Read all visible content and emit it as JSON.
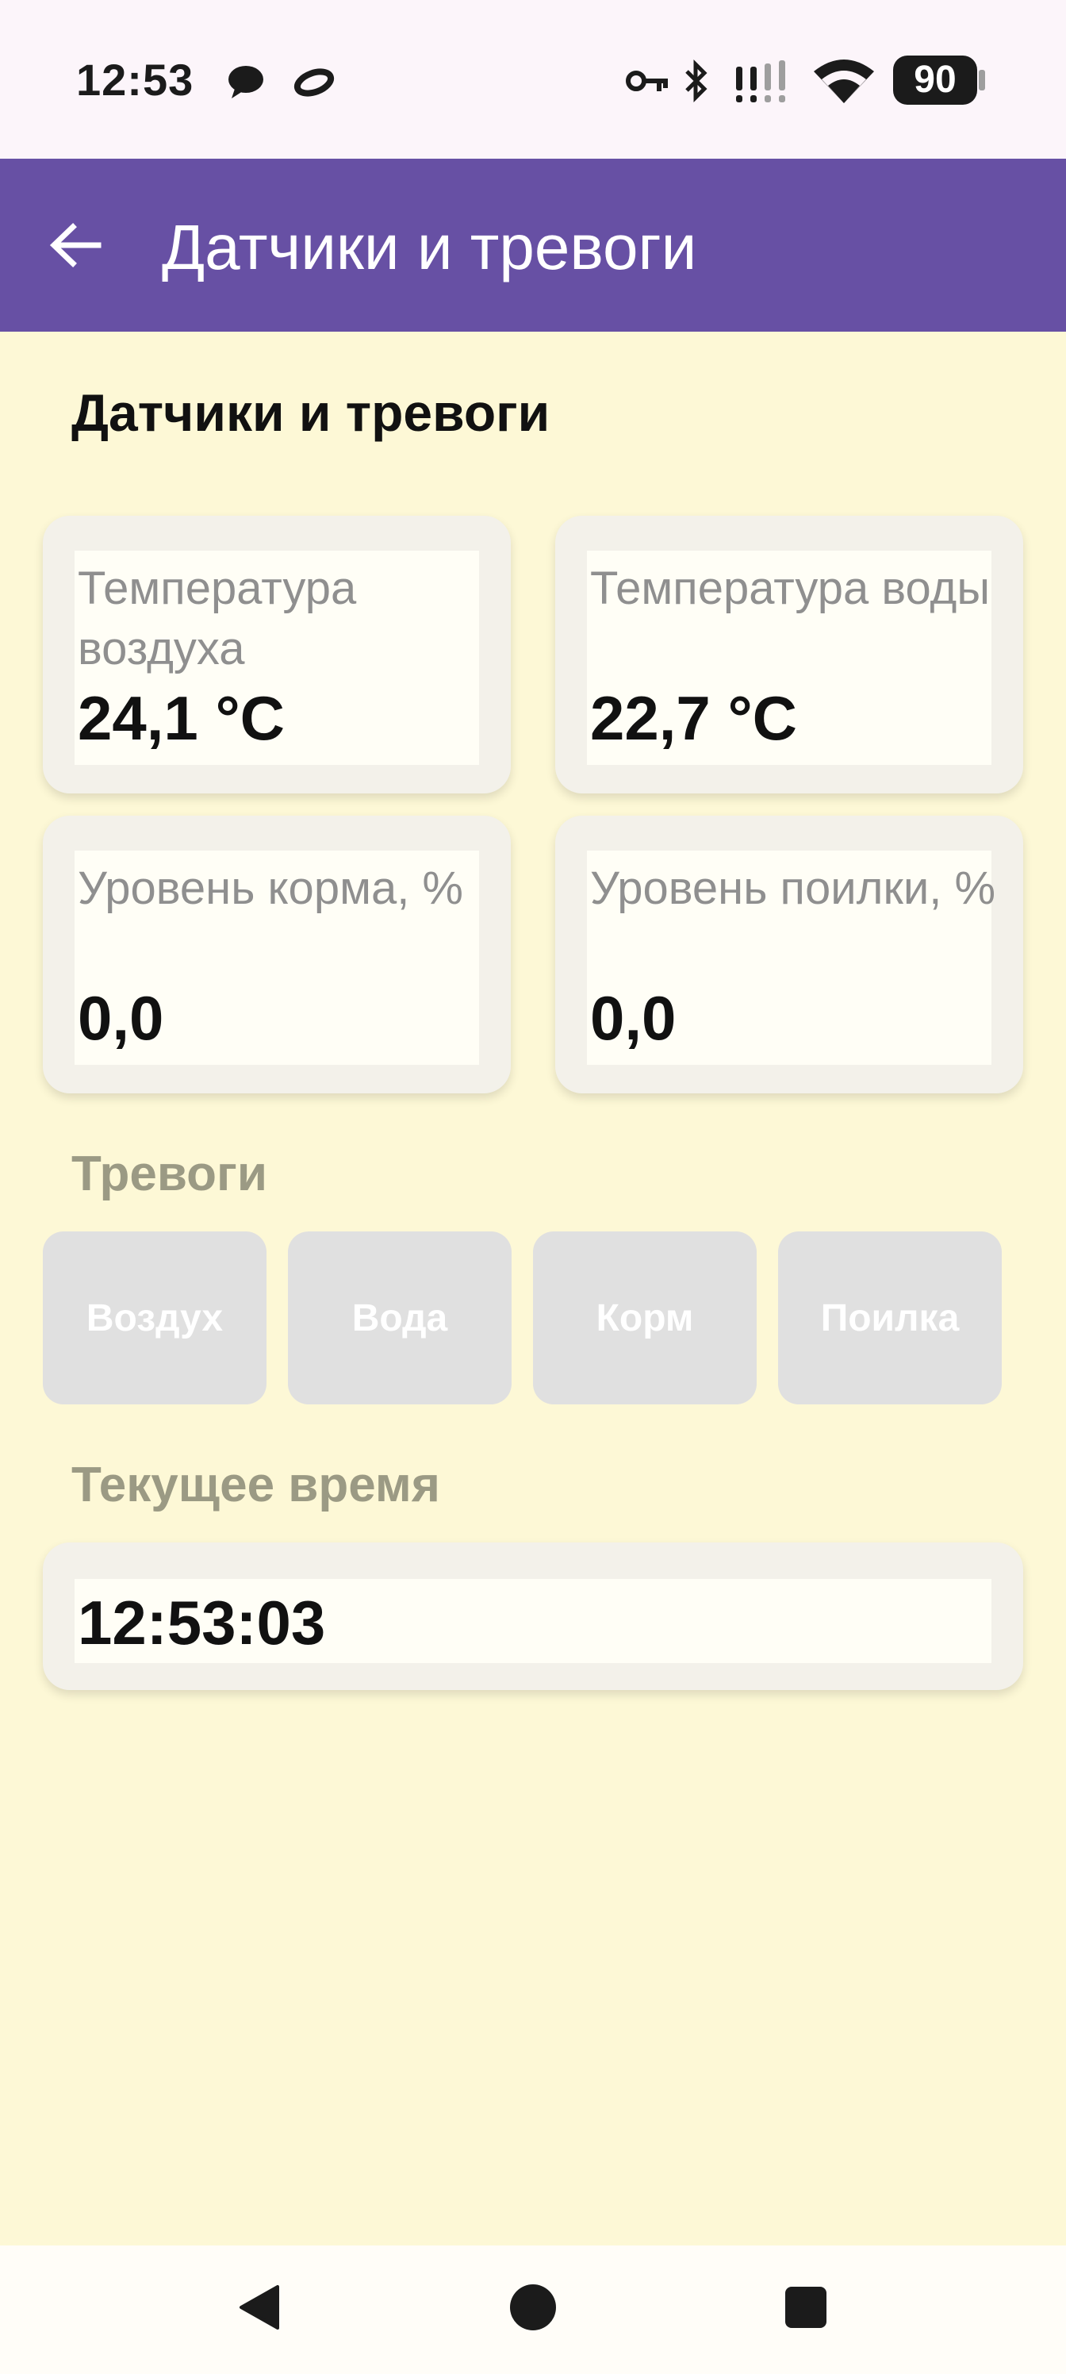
{
  "status_bar": {
    "time": "12:53",
    "battery": "90",
    "icons": [
      "chat-bubble-icon",
      "app-notification-icon",
      "vpn-key-icon",
      "bluetooth-icon",
      "signal-icon",
      "wifi-icon",
      "battery-icon"
    ]
  },
  "app_bar": {
    "title": "Датчики и тревоги",
    "back_icon": "arrow-left-icon",
    "background": "#6750a4"
  },
  "page": {
    "heading": "Датчики и тревоги",
    "background": "#fdf8d6"
  },
  "sensors": [
    {
      "label": "Температура воздуха",
      "value": "24,1 °C"
    },
    {
      "label": "Температура воды",
      "value": "22,7 °C"
    },
    {
      "label": "Уровень корма, %",
      "value": "0,0"
    },
    {
      "label": "Уровень поилки, %",
      "value": "0,0"
    }
  ],
  "alarms": {
    "title": "Тревоги",
    "buttons": [
      "Воздух",
      "Вода",
      "Корм",
      "Поилка"
    ]
  },
  "current_time": {
    "title": "Текущее время",
    "value": "12:53:03"
  },
  "nav": {
    "icons": [
      "back-triangle-icon",
      "home-circle-icon",
      "recents-square-icon"
    ]
  }
}
